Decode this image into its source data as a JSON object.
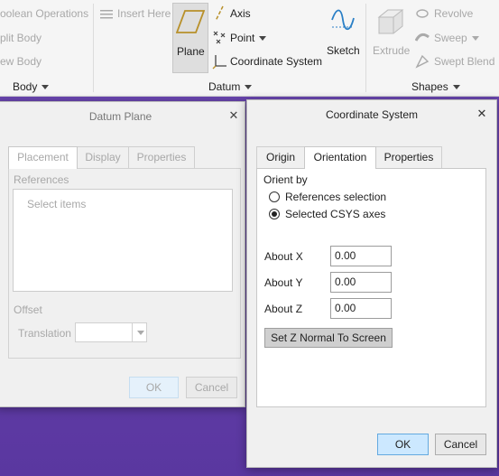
{
  "ribbon": {
    "body_group": {
      "items": [
        "oolean Operations",
        "plit Body",
        "ew Body"
      ],
      "label": "Body"
    },
    "insert_here": "Insert Here",
    "datum_group": {
      "plane": "Plane",
      "axis": "Axis",
      "point": "Point",
      "coordinate_system": "Coordinate System",
      "sketch": "Sketch",
      "label": "Datum"
    },
    "shapes_group": {
      "extrude": "Extrude",
      "revolve": "Revolve",
      "sweep": "Sweep",
      "swept_blend": "Swept Blend",
      "label": "Shapes"
    }
  },
  "datum_plane": {
    "title": "Datum Plane",
    "tabs": [
      "Placement",
      "Display",
      "Properties"
    ],
    "references_label": "References",
    "select_items": "Select items",
    "offset_label": "Offset",
    "translation_label": "Translation",
    "ok": "OK",
    "cancel": "Cancel"
  },
  "coord_system": {
    "title": "Coordinate System",
    "tabs": [
      "Origin",
      "Orientation",
      "Properties"
    ],
    "active_tab": "Orientation",
    "orient_by_label": "Orient by",
    "radio_options": [
      "References selection",
      "Selected CSYS axes"
    ],
    "selected_option": "Selected CSYS axes",
    "about_x_label": "About X",
    "about_x_value": "0.00",
    "about_y_label": "About Y",
    "about_y_value": "0.00",
    "about_z_label": "About Z",
    "about_z_value": "0.00",
    "set_z_button": "Set Z Normal To Screen",
    "ok": "OK",
    "cancel": "Cancel"
  },
  "colors": {
    "accent": "#cce8ff",
    "background": "#5e3b9e",
    "plane_icon": "#b8902a"
  }
}
